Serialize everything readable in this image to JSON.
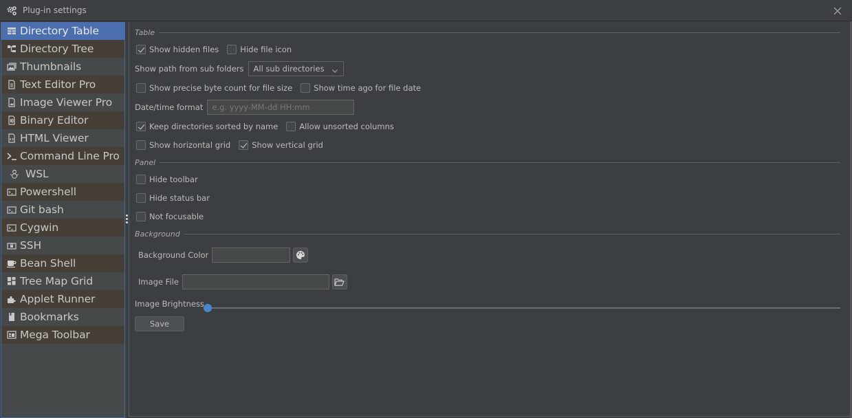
{
  "window": {
    "title": "Plug-in settings",
    "title_icon": "gears-icon",
    "close_icon": "close-icon"
  },
  "sidebar": {
    "selected_index": 0,
    "items": [
      {
        "label": "Directory Table",
        "icon": "table-icon"
      },
      {
        "label": "Directory Tree",
        "icon": "tree-icon"
      },
      {
        "label": "Thumbnails",
        "icon": "image-gallery-icon"
      },
      {
        "label": "Text Editor Pro",
        "icon": "text-file-icon"
      },
      {
        "label": "Image Viewer Pro",
        "icon": "image-file-icon"
      },
      {
        "label": "Binary Editor",
        "icon": "binary-file-icon"
      },
      {
        "label": "HTML Viewer",
        "icon": "html-file-icon"
      },
      {
        "label": "Command Line Pro",
        "icon": "terminal-prompt-icon"
      },
      {
        "label": "WSL",
        "icon": "snowman-icon"
      },
      {
        "label": "Powershell",
        "icon": "console-icon"
      },
      {
        "label": "Git bash",
        "icon": "console-icon"
      },
      {
        "label": "Cygwin",
        "icon": "console-icon"
      },
      {
        "label": "SSH",
        "icon": "lock-console-icon"
      },
      {
        "label": "Bean Shell",
        "icon": "coffee-cup-icon"
      },
      {
        "label": "Tree Map Grid",
        "icon": "treemap-icon"
      },
      {
        "label": "Applet Runner",
        "icon": "puzzle-icon"
      },
      {
        "label": "Bookmarks",
        "icon": "bookmark-icon"
      },
      {
        "label": "Mega Toolbar",
        "icon": "toolbar-icon"
      }
    ]
  },
  "table_section": {
    "title": "Table",
    "show_hidden_files": {
      "label": "Show hidden files",
      "checked": true
    },
    "hide_file_icon": {
      "label": "Hide file icon",
      "checked": false
    },
    "show_path_label": "Show path from sub folders",
    "show_path_value": "All sub directories",
    "precise_byte_count": {
      "label": "Show precise byte count for file size",
      "checked": false
    },
    "time_ago": {
      "label": "Show time ago for file date",
      "checked": false
    },
    "datetime_label": "Date/time format",
    "datetime_value": "",
    "datetime_placeholder": "e.g. yyyy-MM-dd HH:mm",
    "keep_sorted": {
      "label": "Keep directories sorted by name",
      "checked": true
    },
    "allow_unsorted": {
      "label": "Allow unsorted columns",
      "checked": false
    },
    "horizontal_grid": {
      "label": "Show horizontal grid",
      "checked": false
    },
    "vertical_grid": {
      "label": "Show vertical grid",
      "checked": true
    }
  },
  "panel_section": {
    "title": "Panel",
    "hide_toolbar": {
      "label": "Hide toolbar",
      "checked": false
    },
    "hide_status_bar": {
      "label": "Hide status bar",
      "checked": false
    },
    "not_focusable": {
      "label": "Not focusable",
      "checked": false
    }
  },
  "background_section": {
    "title": "Background",
    "color_label": "Background Color",
    "color_value": "",
    "image_label": "Image File",
    "image_value": "",
    "brightness_label": "Image Brightness",
    "brightness_value_percent": 0
  },
  "save_label": "Save",
  "colors": {
    "selected": "#4b6eaf",
    "accent": "#4a88c7",
    "background": "#3c3f41"
  }
}
